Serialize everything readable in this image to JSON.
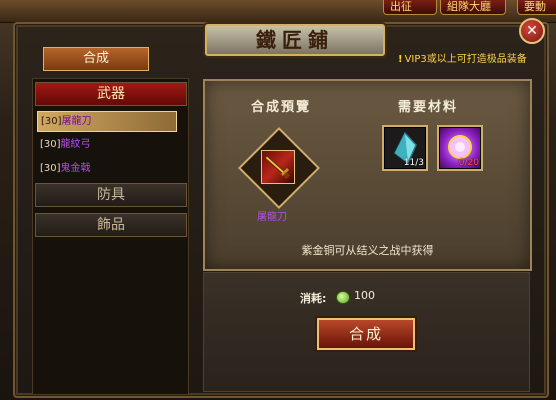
{
  "top_tabs": {
    "chuzheng": "出征",
    "zudui": "組隊大廳",
    "yaodong": "要動"
  },
  "window": {
    "title": "鐵匠鋪",
    "close_icon": "close-icon"
  },
  "synth_tab_label": "合成",
  "vip_note": "VIP3或以上可打造极品装备",
  "categories": {
    "weapon": "武器",
    "armor": "防具",
    "jewelry": "飾品"
  },
  "items": [
    {
      "level": "[30]",
      "name": "屠龍刀",
      "selected": true
    },
    {
      "level": "[30]",
      "name": "龍紋弓",
      "selected": false
    },
    {
      "level": "[30]",
      "name": "鬼金戟",
      "selected": false
    }
  ],
  "preview": {
    "preview_heading": "合成預覽",
    "materials_heading": "需要材料",
    "item_name": "屠龍刀",
    "item_icon": "sword-icon",
    "materials": [
      {
        "icon": "crystal-icon",
        "count": "11/3"
      },
      {
        "icon": "orb-icon",
        "count": "0/20"
      }
    ],
    "source": "紫金铜可从结义之战中获得"
  },
  "cost": {
    "label": "消耗:",
    "value": "100",
    "icon": "coin-icon"
  },
  "button_synthesize": "合成",
  "colors": {
    "accent": "#b64cf0",
    "gold": "#cfae6c",
    "red": "#a31813"
  }
}
